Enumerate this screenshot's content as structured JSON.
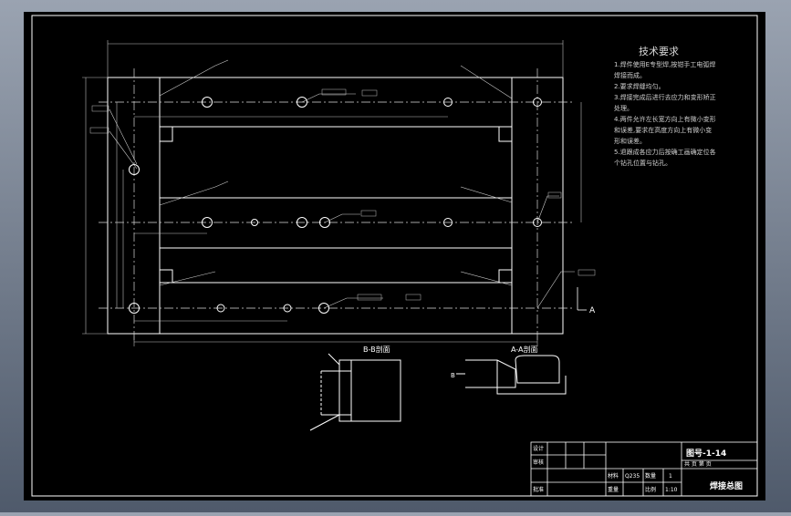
{
  "tech": {
    "title": "技术要求",
    "lines": [
      "1.焊件使用E专型焊,按钳手工电弧焊",
      "焊接而成。",
      "2.要求焊缝均匀。",
      "3.焊接完成后进行去应力和变形矫正",
      "处理。",
      "4.两件允许左长宽方向上有微小变形",
      "和误差,要求在高度方向上有微小变",
      "形和误差。",
      "5.退跟成各应力后按确工画确定位各",
      "个钻孔位置与钻孔。"
    ]
  },
  "sections": {
    "bb": "B-B剖面",
    "aa": "A-A剖面",
    "a_mark": "A",
    "b_mark": "B"
  },
  "titleblock": {
    "drawing_no": "图号-1-14",
    "sub": "共 页 第 页",
    "name": "焊接总图",
    "design": "设计",
    "check": "审核",
    "approve": "批准",
    "mat_label": "材料",
    "mat_value": "Q235",
    "qty_label": "数量",
    "qty_value": "1",
    "weight_label": "重量",
    "scale_label": "比例",
    "scale_value": "1:10"
  },
  "colors": {
    "background": "#000000",
    "line": "#ffffff",
    "dim": "#bdbdbd"
  }
}
